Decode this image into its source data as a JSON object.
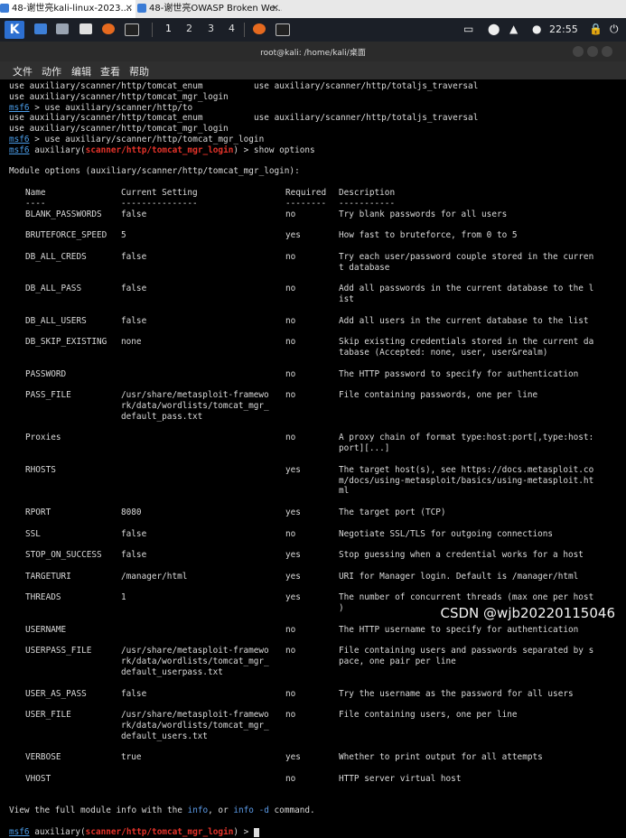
{
  "browser_tabs": [
    {
      "label": "48-谢世亮kali-linux-2023...."
    },
    {
      "label": "48-谢世亮OWASP Broken We..."
    }
  ],
  "panel": {
    "workspaces": [
      "1",
      "2",
      "3",
      "4"
    ],
    "clock": "22:55"
  },
  "window": {
    "title": "root@kali: /home/kali/桌面"
  },
  "menubar": [
    "文件",
    "动作",
    "编辑",
    "查看",
    "帮助"
  ],
  "prompt": "msf6",
  "terminal": {
    "top_lines": [
      {
        "kind": "plain",
        "c1": "use auxiliary/scanner/http/tomcat_enum",
        "c2": "use auxiliary/scanner/http/totaljs_traversal"
      },
      {
        "kind": "plain",
        "c1": "use auxiliary/scanner/http/tomcat_mgr_login",
        "c2": ""
      },
      {
        "kind": "prompt",
        "text": " > use auxiliary/scanner/http/to"
      },
      {
        "kind": "plain",
        "c1": "use auxiliary/scanner/http/tomcat_enum",
        "c2": "use auxiliary/scanner/http/totaljs_traversal"
      },
      {
        "kind": "plain",
        "c1": "use auxiliary/scanner/http/tomcat_mgr_login",
        "c2": ""
      },
      {
        "kind": "prompt",
        "text": " > use auxiliary/scanner/http/tomcat_mgr_login"
      },
      {
        "kind": "prompt_mod",
        "pre": " auxiliary(",
        "mod": "scanner/http/tomcat_mgr_login",
        "post": ") > show options"
      }
    ],
    "module_options_header": "Module options (auxiliary/scanner/http/tomcat_mgr_login):",
    "columns": {
      "name": "Name",
      "setting": "Current Setting",
      "required": "Required",
      "description": "Description"
    },
    "underlines": {
      "name": "----",
      "setting": "---------------",
      "required": "--------",
      "description": "-----------"
    },
    "options": [
      {
        "name": "BLANK_PASSWORDS",
        "setting": [
          "false"
        ],
        "required": "no",
        "desc": [
          "Try blank passwords for all users"
        ]
      },
      {
        "name": "BRUTEFORCE_SPEED",
        "setting": [
          "5"
        ],
        "required": "yes",
        "desc": [
          "How fast to bruteforce, from 0 to 5"
        ]
      },
      {
        "name": "DB_ALL_CREDS",
        "setting": [
          "false"
        ],
        "required": "no",
        "desc": [
          "Try each user/password couple stored in the curren",
          "t database"
        ]
      },
      {
        "name": "DB_ALL_PASS",
        "setting": [
          "false"
        ],
        "required": "no",
        "desc": [
          "Add all passwords in the current database to the l",
          "ist"
        ]
      },
      {
        "name": "DB_ALL_USERS",
        "setting": [
          "false"
        ],
        "required": "no",
        "desc": [
          "Add all users in the current database to the list"
        ]
      },
      {
        "name": "DB_SKIP_EXISTING",
        "setting": [
          "none"
        ],
        "required": "no",
        "desc": [
          "Skip existing credentials stored in the current da",
          "tabase (Accepted: none, user, user&realm)"
        ]
      },
      {
        "name": "PASSWORD",
        "setting": [
          ""
        ],
        "required": "no",
        "desc": [
          "The HTTP password to specify for authentication"
        ]
      },
      {
        "name": "PASS_FILE",
        "setting": [
          "/usr/share/metasploit-framewo",
          "rk/data/wordlists/tomcat_mgr_",
          "default_pass.txt"
        ],
        "required": "no",
        "desc": [
          "File containing passwords, one per line"
        ]
      },
      {
        "name": "Proxies",
        "setting": [
          ""
        ],
        "required": "no",
        "desc": [
          "A proxy chain of format type:host:port[,type:host:",
          "port][...]"
        ]
      },
      {
        "name": "RHOSTS",
        "setting": [
          ""
        ],
        "required": "yes",
        "desc": [
          "The target host(s), see https://docs.metasploit.co",
          "m/docs/using-metasploit/basics/using-metasploit.ht",
          "ml"
        ]
      },
      {
        "name": "RPORT",
        "setting": [
          "8080"
        ],
        "required": "yes",
        "desc": [
          "The target port (TCP)"
        ]
      },
      {
        "name": "SSL",
        "setting": [
          "false"
        ],
        "required": "no",
        "desc": [
          "Negotiate SSL/TLS for outgoing connections"
        ]
      },
      {
        "name": "STOP_ON_SUCCESS",
        "setting": [
          "false"
        ],
        "required": "yes",
        "desc": [
          "Stop guessing when a credential works for a host"
        ]
      },
      {
        "name": "TARGETURI",
        "setting": [
          "/manager/html"
        ],
        "required": "yes",
        "desc": [
          "URI for Manager login. Default is /manager/html"
        ]
      },
      {
        "name": "THREADS",
        "setting": [
          "1"
        ],
        "required": "yes",
        "desc": [
          "The number of concurrent threads (max one per host",
          ")"
        ]
      },
      {
        "name": "USERNAME",
        "setting": [
          ""
        ],
        "required": "no",
        "desc": [
          "The HTTP username to specify for authentication"
        ]
      },
      {
        "name": "USERPASS_FILE",
        "setting": [
          "/usr/share/metasploit-framewo",
          "rk/data/wordlists/tomcat_mgr_",
          "default_userpass.txt"
        ],
        "required": "no",
        "desc": [
          "File containing users and passwords separated by s",
          "pace, one pair per line"
        ]
      },
      {
        "name": "USER_AS_PASS",
        "setting": [
          "false"
        ],
        "required": "no",
        "desc": [
          "Try the username as the password for all users"
        ]
      },
      {
        "name": "USER_FILE",
        "setting": [
          "/usr/share/metasploit-framewo",
          "rk/data/wordlists/tomcat_mgr_",
          "default_users.txt"
        ],
        "required": "no",
        "desc": [
          "File containing users, one per line"
        ]
      },
      {
        "name": "VERBOSE",
        "setting": [
          "true"
        ],
        "required": "yes",
        "desc": [
          "Whether to print output for all attempts"
        ]
      },
      {
        "name": "VHOST",
        "setting": [
          ""
        ],
        "required": "no",
        "desc": [
          "HTTP server virtual host"
        ]
      }
    ],
    "footer": {
      "pre": "View the full module info with the ",
      "info": "info",
      "mid": ", or ",
      "info_d": "info -d",
      "post": " command."
    },
    "final_prompt": {
      "pre": " auxiliary(",
      "mod": "scanner/http/tomcat_mgr_login",
      "post": ") > "
    }
  },
  "watermark": "CSDN @wjb20220115046",
  "colors": {
    "prompt_blue": "#4a9ce8",
    "module_red": "#e5332a",
    "terminal_bg": "#000000",
    "text": "#dadada"
  }
}
